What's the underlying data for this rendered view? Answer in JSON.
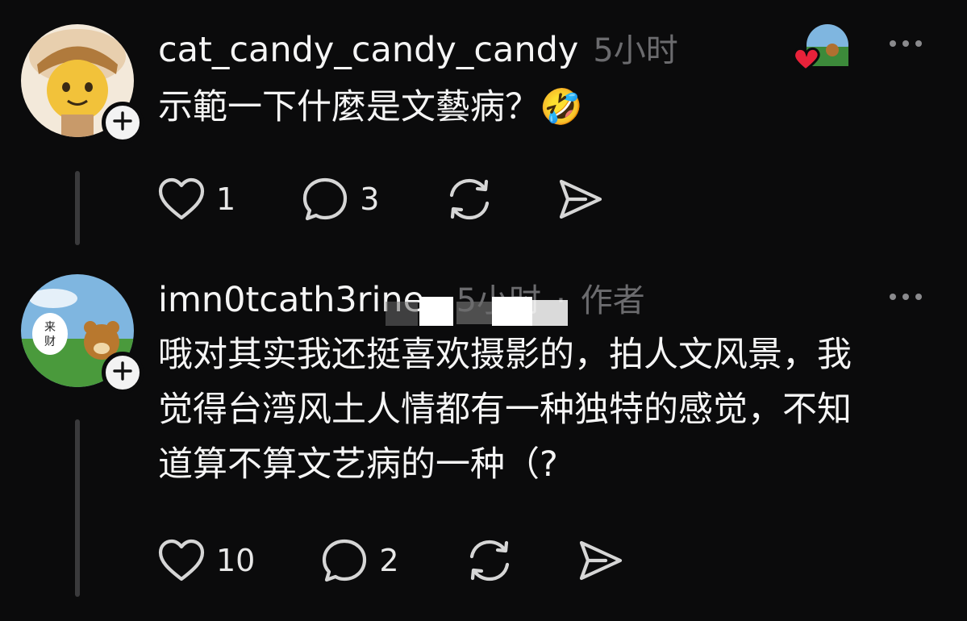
{
  "posts": [
    {
      "username": "cat_candy_candy_candy",
      "time": "5小时",
      "text": "示範一下什麼是文藝病？🤣",
      "likes": "1",
      "replies": "3"
    },
    {
      "username": "imn0tcath3rine_",
      "time": "5小时",
      "separator": "·",
      "author_tag": "作者",
      "text_lines": [
        "哦对其实我还挺喜欢摄影的，拍人文风景，我",
        "觉得台湾风土人情都有一种独特的感觉，不知",
        "道算不算文艺病的一种（?"
      ],
      "likes": "10",
      "replies": "2",
      "avatar_sign": "来财"
    }
  ],
  "icons": [
    "heart-icon",
    "comment-icon",
    "repost-icon",
    "share-icon",
    "more-icon",
    "plus-icon"
  ],
  "colors": {
    "background": "#0b0b0c",
    "text": "#f5f5f5",
    "muted": "#6b6b6e",
    "like": "#e8223a"
  }
}
